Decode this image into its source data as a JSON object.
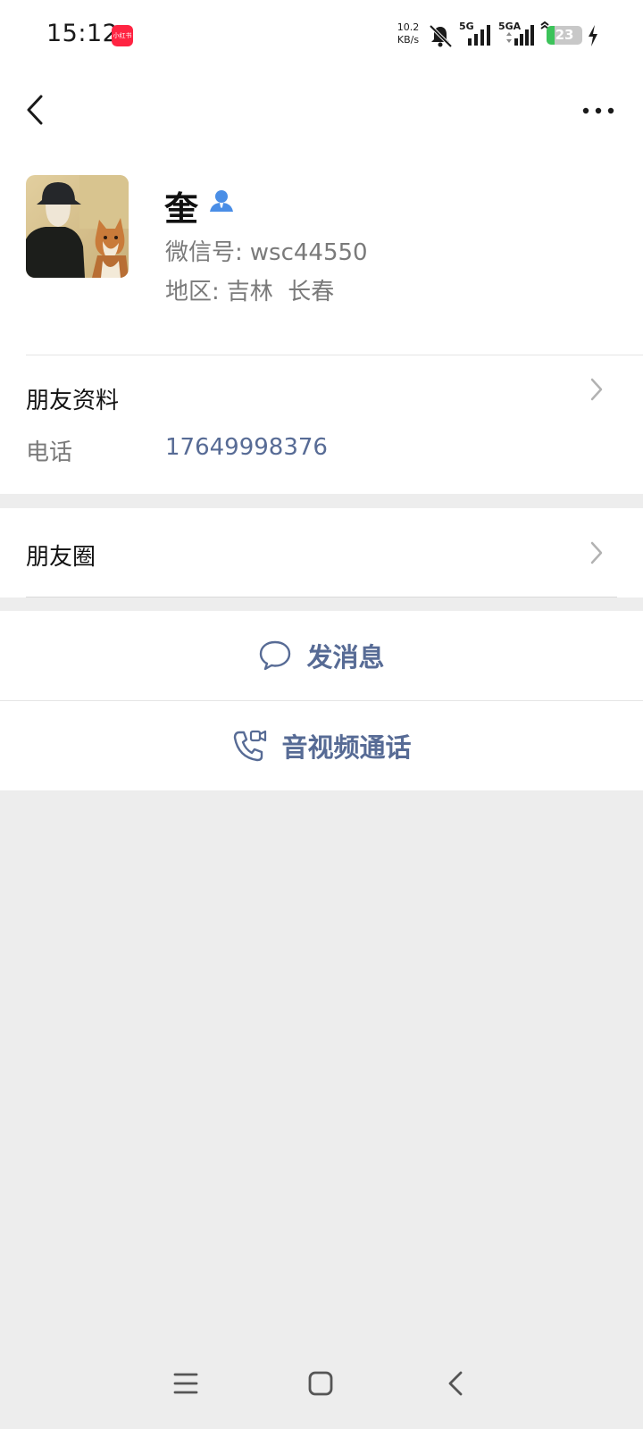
{
  "status_bar": {
    "time": "15:12",
    "app_badge": "小红书",
    "net_speed_value": "10.2",
    "net_speed_unit": "KB/s",
    "sim1_label": "5G",
    "sim2_label": "5GA",
    "battery_level": "23",
    "battery_fraction": 0.23,
    "charging": true,
    "colors": {
      "battery_fill": "#3cc35a",
      "badge": "#ff2442"
    },
    "icons": [
      "bell-muted-icon",
      "signal-icon",
      "battery-icon",
      "charging-bolt-icon"
    ]
  },
  "nav": {
    "back_icon": "chevron-left-icon",
    "more_icon": "more-dots-icon"
  },
  "profile": {
    "name": "奎",
    "wechat_id_label": "微信号:",
    "wechat_id": "wsc44550",
    "region_label": "地区:",
    "region": "吉林  长春"
  },
  "friend_info": {
    "title": "朋友资料",
    "phone_label": "电话",
    "phone": "17649998376"
  },
  "moments": {
    "title": "朋友圈"
  },
  "actions": {
    "message": "发消息",
    "call": "音视频通话"
  },
  "colors": {
    "link": "#576b95",
    "background": "#ededed",
    "card": "#ffffff"
  }
}
